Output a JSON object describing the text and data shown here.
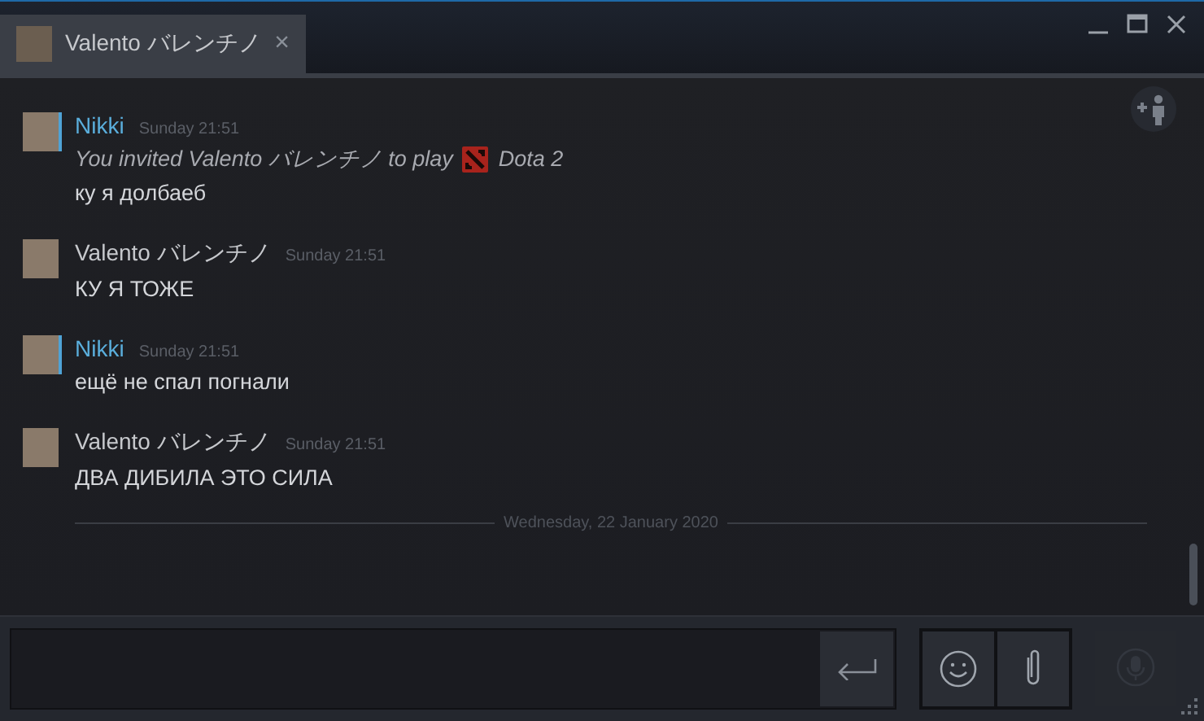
{
  "tab": {
    "title": "Valento バレンチノ",
    "close": "×"
  },
  "messages": [
    {
      "sender": "Nikki",
      "kind": "self",
      "time": "Sunday 21:51",
      "lines": [
        {
          "kind": "invite",
          "text": "You invited Valento バレンチノ to play",
          "game": "Dota 2"
        },
        {
          "kind": "text",
          "text": "ку я долбаеб"
        }
      ]
    },
    {
      "sender": "Valento バレンチノ",
      "kind": "friend",
      "time": "Sunday 21:51",
      "lines": [
        {
          "kind": "text",
          "text": "КУ Я ТОЖЕ"
        }
      ]
    },
    {
      "sender": "Nikki",
      "kind": "self",
      "time": "Sunday 21:51",
      "lines": [
        {
          "kind": "text",
          "text": "ещё не спал погнали"
        }
      ]
    },
    {
      "sender": "Valento バレンチノ",
      "kind": "friend",
      "time": "Sunday 21:51",
      "lines": [
        {
          "kind": "text",
          "text": "ДВА ДИБИЛА ЭТО СИЛА"
        }
      ]
    }
  ],
  "date_divider": "Wednesday, 22 January 2020"
}
